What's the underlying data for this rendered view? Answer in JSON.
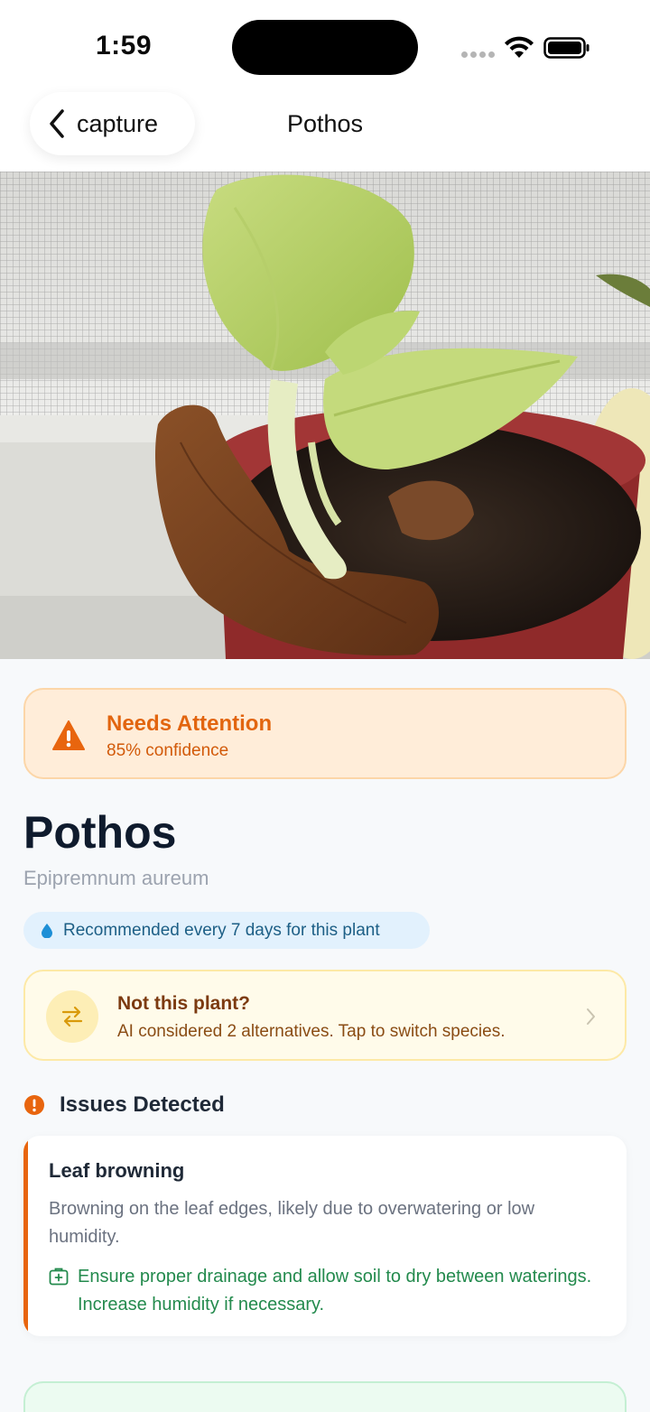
{
  "status_bar": {
    "time": "1:59"
  },
  "nav": {
    "back_label": "capture",
    "title": "Pothos"
  },
  "photo": {
    "alt": "Pothos plant in pot"
  },
  "status": {
    "title": "Needs Attention",
    "confidence": "85% confidence",
    "color": "#e2650f"
  },
  "plant": {
    "name": "Pothos",
    "scientific_name": "Epipremnum aureum",
    "watering": "Recommended every 7 days for this plant"
  },
  "alternatives": {
    "title": "Not this plant?",
    "subtitle": "AI considered 2 alternatives. Tap to switch species."
  },
  "issues": {
    "header": "Issues Detected",
    "items": [
      {
        "title": "Leaf browning",
        "description": "Browning on the leaf edges, likely due to overwatering or low humidity.",
        "fix": "Ensure proper drainage and allow soil to dry between waterings. Increase humidity if necessary."
      }
    ]
  },
  "colors": {
    "accent_orange": "#e8650e",
    "fix_green": "#238a4d",
    "water_blue": "#1d5f86"
  }
}
